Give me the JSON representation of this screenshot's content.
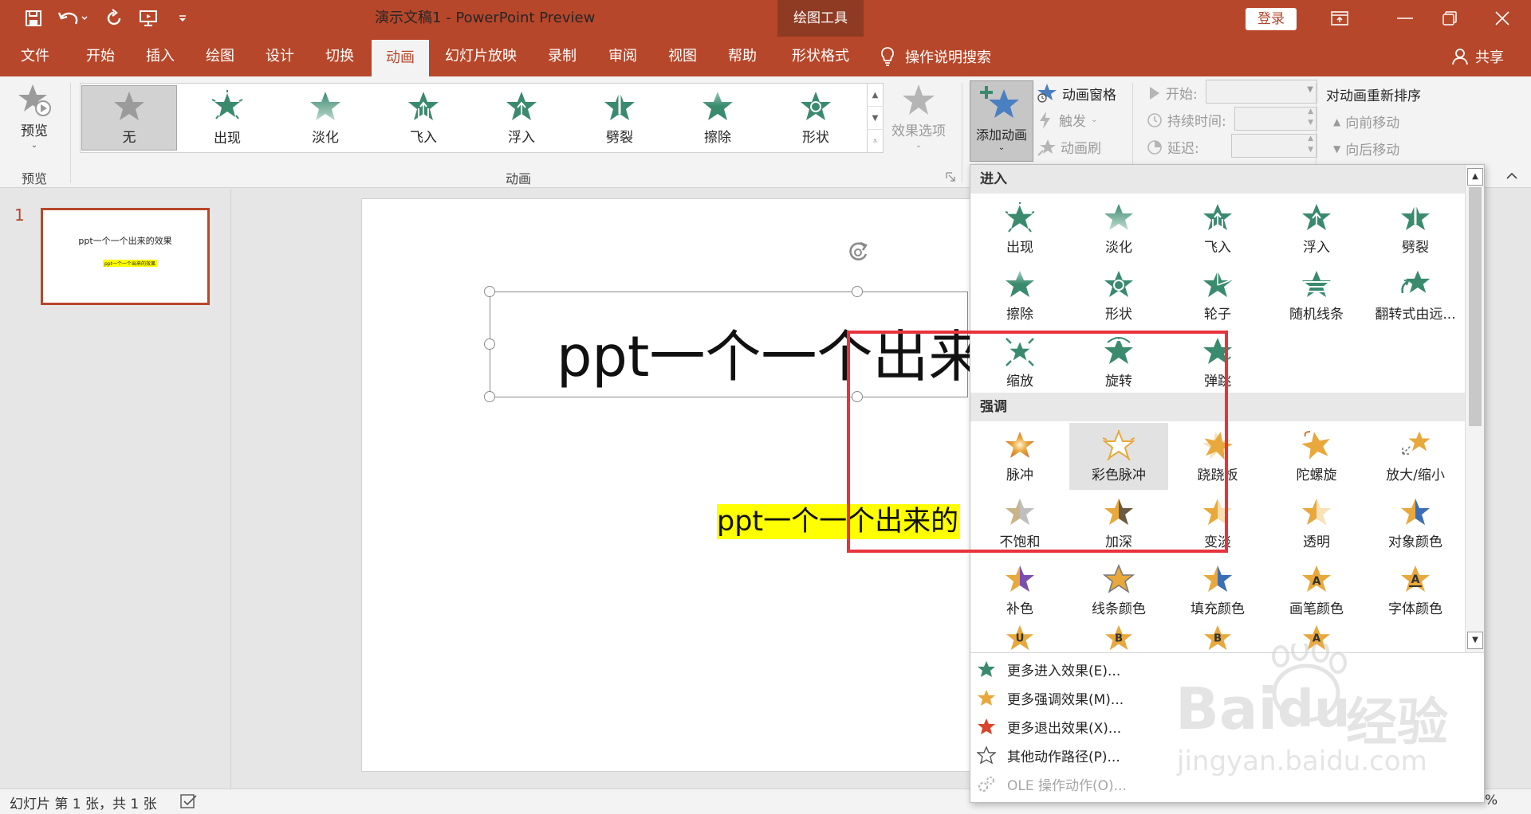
{
  "window": {
    "doc_title": "演示文稿1  -  PowerPoint Preview",
    "tools_label": "绘图工具",
    "login": "登录"
  },
  "tabs": [
    "文件",
    "开始",
    "插入",
    "绘图",
    "设计",
    "切换",
    "动画",
    "幻灯片放映",
    "录制",
    "审阅",
    "视图",
    "帮助",
    "形状格式"
  ],
  "active_tab": "动画",
  "tell_me": "操作说明搜索",
  "share": "共享",
  "ribbon": {
    "preview_label": "预览",
    "preview_group": "预览",
    "animation_group": "动画",
    "gallery": [
      "无",
      "出现",
      "淡化",
      "飞入",
      "浮入",
      "劈裂",
      "擦除",
      "形状"
    ],
    "effect_options": "效果选项",
    "add_animation": "添加动画",
    "animation_pane": "动画窗格",
    "trigger": "触发",
    "animation_painter": "动画刷",
    "start": "开始:",
    "duration": "持续时间:",
    "delay": "延迟:",
    "reorder_title": "对动画重新排序",
    "move_earlier": "向前移动",
    "move_later": "向后移动"
  },
  "slides": {
    "number": "1",
    "thumb_title": "ppt一个一个出来的效果",
    "thumb_sub": "ppt一个一个出来的效果"
  },
  "slide": {
    "title": "ppt一个一个出来",
    "subtitle": "ppt一个一个出来的"
  },
  "dropdown": {
    "entrance_header": "进入",
    "entrance": [
      "出现",
      "淡化",
      "飞入",
      "浮入",
      "劈裂",
      "擦除",
      "形状",
      "轮子",
      "随机线条",
      "翻转式由远...",
      "缩放",
      "旋转",
      "弹跳"
    ],
    "emphasis_header": "强调",
    "emphasis": [
      "脉冲",
      "彩色脉冲",
      "跷跷板",
      "陀螺旋",
      "放大/缩小",
      "不饱和",
      "加深",
      "变淡",
      "透明",
      "对象颜色",
      "补色",
      "线条颜色",
      "填充颜色",
      "画笔颜色",
      "字体颜色"
    ],
    "emphasis_partial_letters": [
      "U",
      "B",
      "B",
      "A"
    ],
    "selected": "彩色脉冲",
    "more": {
      "entrance": "更多进入效果(E)...",
      "emphasis": "更多强调效果(M)...",
      "exit": "更多退出效果(X)...",
      "path": "其他动作路径(P)...",
      "ole": "OLE 操作动作(O)..."
    }
  },
  "status": {
    "slide_info": "幻灯片 第 1 张，共 1 张",
    "zoom_fragment": "%"
  },
  "watermark": {
    "brand": "Bai",
    "brand2": "du",
    "cn": "经验",
    "url": "jingyan.baidu.com"
  },
  "colors": {
    "accent": "#b7472a",
    "entrance_star": "#3a8a6e",
    "emphasis_star": "#e8a83c",
    "exit_star": "#d9442a",
    "annotation_red": "#e8323c"
  }
}
